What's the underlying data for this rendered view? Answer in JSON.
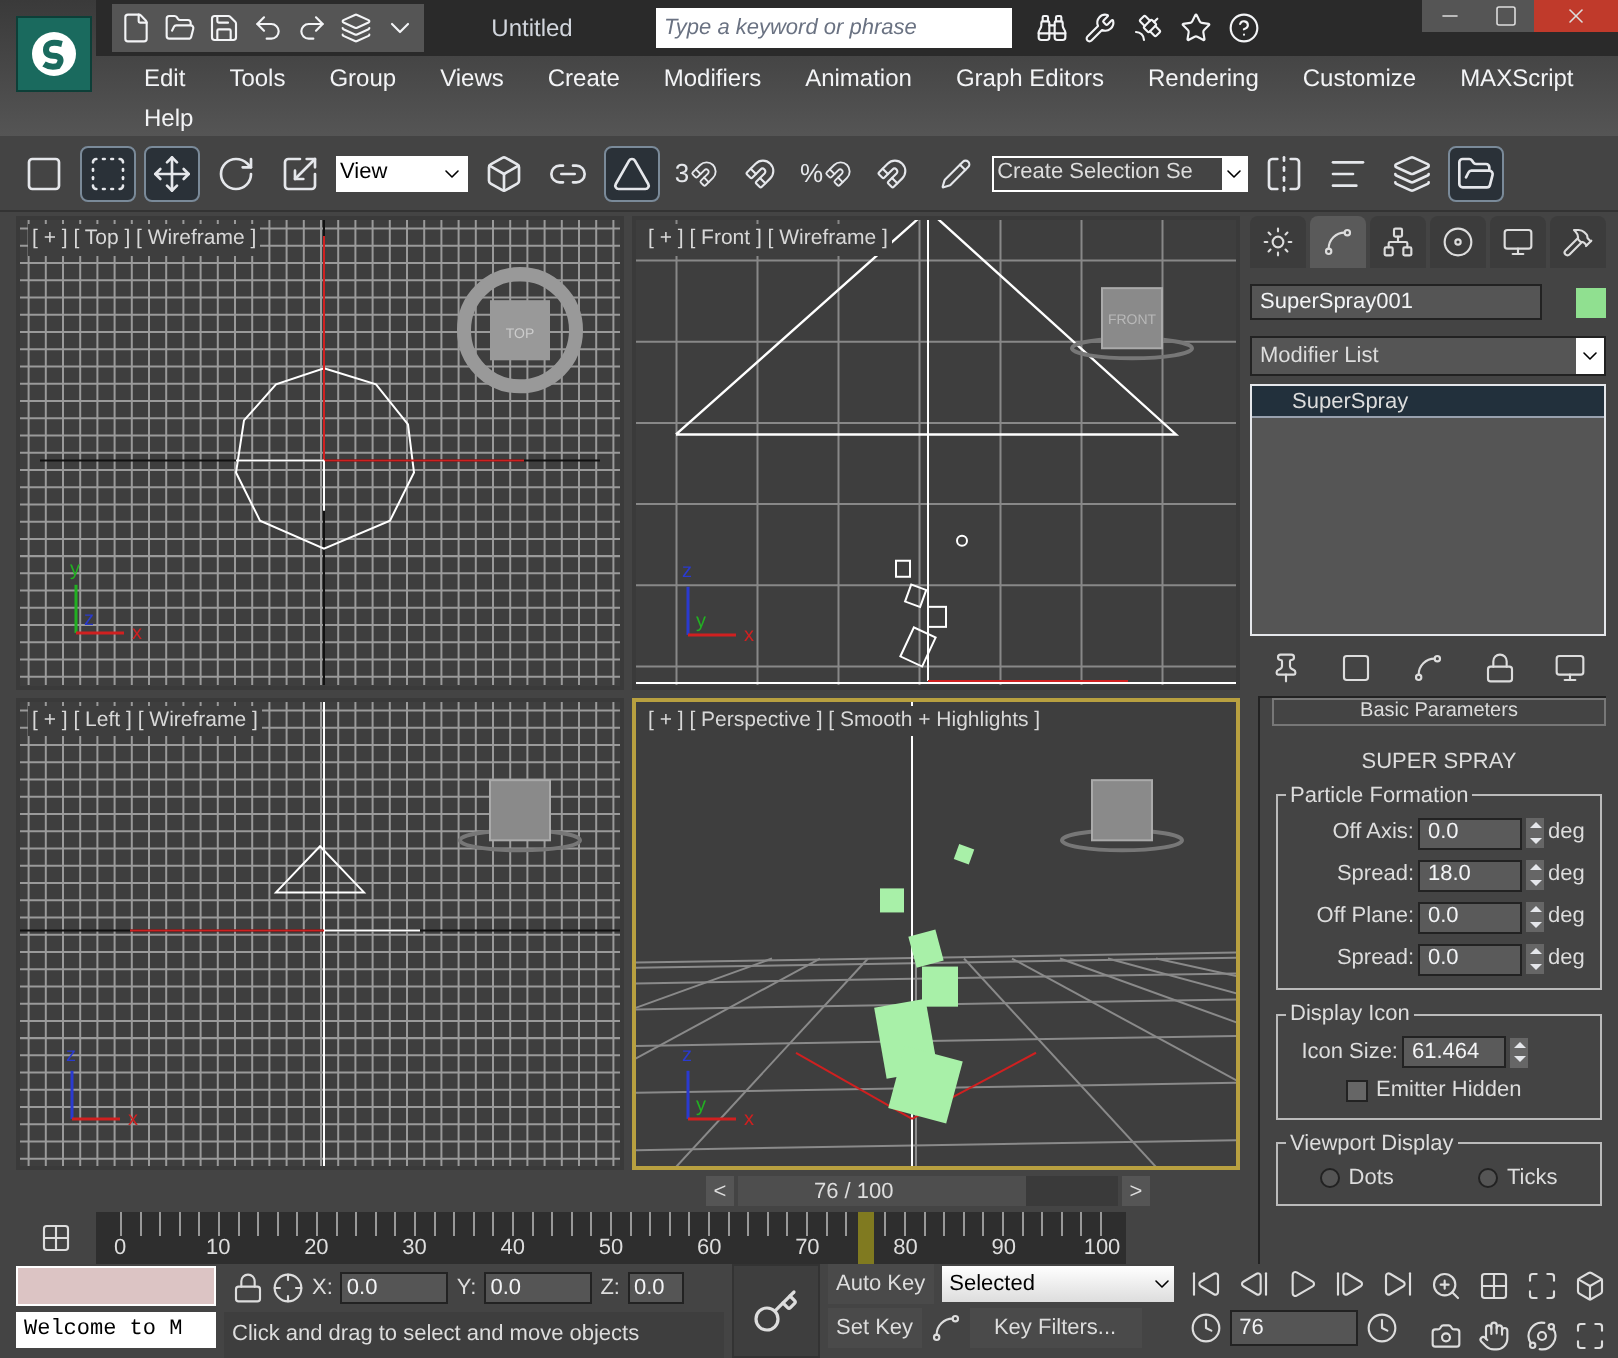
{
  "title_bar": {
    "title": "Untitled",
    "search": {
      "placeholder": "Type a keyword or phrase"
    }
  },
  "menu": [
    "Edit",
    "Tools",
    "Group",
    "Views",
    "Create",
    "Modifiers",
    "Animation",
    "Graph Editors",
    "Rendering",
    "Customize",
    "MAXScript",
    "Help"
  ],
  "toolbar": {
    "tools": [
      {
        "kind": "select-region",
        "selected": false
      },
      {
        "kind": "select-object",
        "selected": true
      },
      {
        "kind": "move",
        "selected": true
      },
      {
        "kind": "rotate",
        "selected": false
      },
      {
        "kind": "scale",
        "selected": false
      }
    ],
    "reference": "View",
    "pivot_selected": true,
    "snap_angle": "3",
    "snap_percent": "%",
    "selection_set": "Create Selection Se"
  },
  "viewports": [
    {
      "kind": "top",
      "label": "[ + ] [ Top ] [ Wireframe ]",
      "active": false,
      "cube": "TOP",
      "tripod": [
        {
          "label": "y",
          "color": "#22b022"
        },
        {
          "label": "z",
          "color": "#2a3ad0"
        },
        {
          "label": "x",
          "color": "#d02020"
        }
      ]
    },
    {
      "kind": "front",
      "label": "[ + ] [ Front ] [ Wireframe ]",
      "active": false,
      "cube": "FRONT",
      "tripod": [
        {
          "label": "z",
          "color": "#2a3ad0"
        },
        {
          "label": "y",
          "color": "#22b022"
        },
        {
          "label": "x",
          "color": "#d02020"
        }
      ]
    },
    {
      "kind": "left",
      "label": "[ + ] [ Left ] [ Wireframe ]",
      "active": false,
      "tripod": [
        {
          "label": "z",
          "color": "#2a3ad0"
        },
        {
          "label": "x",
          "color": "#d02020"
        }
      ]
    },
    {
      "kind": "perspective",
      "label": "[ + ] [ Perspective ] [ Smooth + Highlights ]",
      "active": true,
      "tripod": [
        {
          "label": "z",
          "color": "#2a3ad0"
        },
        {
          "label": "y",
          "color": "#22b022"
        },
        {
          "label": "x",
          "color": "#d02020"
        }
      ]
    }
  ],
  "command_panel": {
    "tabs": [
      {
        "kind": "create",
        "selected": false
      },
      {
        "kind": "modify",
        "selected": true
      },
      {
        "kind": "hierarchy",
        "selected": false
      },
      {
        "kind": "motion",
        "selected": false
      },
      {
        "kind": "display",
        "selected": false
      },
      {
        "kind": "utilities",
        "selected": false
      }
    ],
    "object": {
      "name": "SuperSpray001",
      "color": "#90e090"
    },
    "modifier_list": "Modifier List",
    "stack": [
      {
        "label": "SuperSpray",
        "selected": true
      }
    ],
    "rollout_title": "Basic Parameters",
    "heading": "SUPER SPRAY",
    "groups": [
      {
        "title": "Particle Formation",
        "rows": [
          {
            "kind": "spinner",
            "label": "Off Axis:",
            "value": "0.0",
            "unit": "deg"
          },
          {
            "kind": "spinner",
            "label": "Spread:",
            "value": "18.0",
            "unit": "deg"
          },
          {
            "kind": "spinner",
            "label": "Off Plane:",
            "value": "0.0",
            "unit": "deg"
          },
          {
            "kind": "spinner",
            "label": "Spread:",
            "value": "0.0",
            "unit": "deg"
          }
        ]
      },
      {
        "title": "Display Icon",
        "rows": [
          {
            "kind": "spinner",
            "label": "Icon Size:",
            "value": "61.464"
          },
          {
            "kind": "checkbox",
            "label": "Emitter Hidden",
            "checked": false
          }
        ]
      },
      {
        "title": "Viewport Display",
        "rows": [
          {
            "kind": "radios",
            "options": [
              {
                "label": "Dots",
                "selected": false
              },
              {
                "label": "Ticks",
                "selected": false
              }
            ]
          }
        ]
      }
    ]
  },
  "time_slider": {
    "prev": "<",
    "reading": "76 / 100",
    "next": ">",
    "level": 0.76
  },
  "track_bar": {
    "ticks": [
      "0",
      "10",
      "20",
      "30",
      "40",
      "50",
      "60",
      "70",
      "80",
      "90",
      "100"
    ],
    "level": 0.76
  },
  "status": {
    "listener": "Welcome to M",
    "coordinates": [
      {
        "label": "X:",
        "value": "0.0"
      },
      {
        "label": "Y:",
        "value": "0.0"
      },
      {
        "label": "Z:",
        "value": "0.0"
      }
    ],
    "prompt": "Click and drag to select and move objects",
    "auto_key": "Auto Key",
    "set_key": "Set Key",
    "key_mode": "Selected",
    "key_filters": "Key Filters...",
    "frame": "76"
  }
}
